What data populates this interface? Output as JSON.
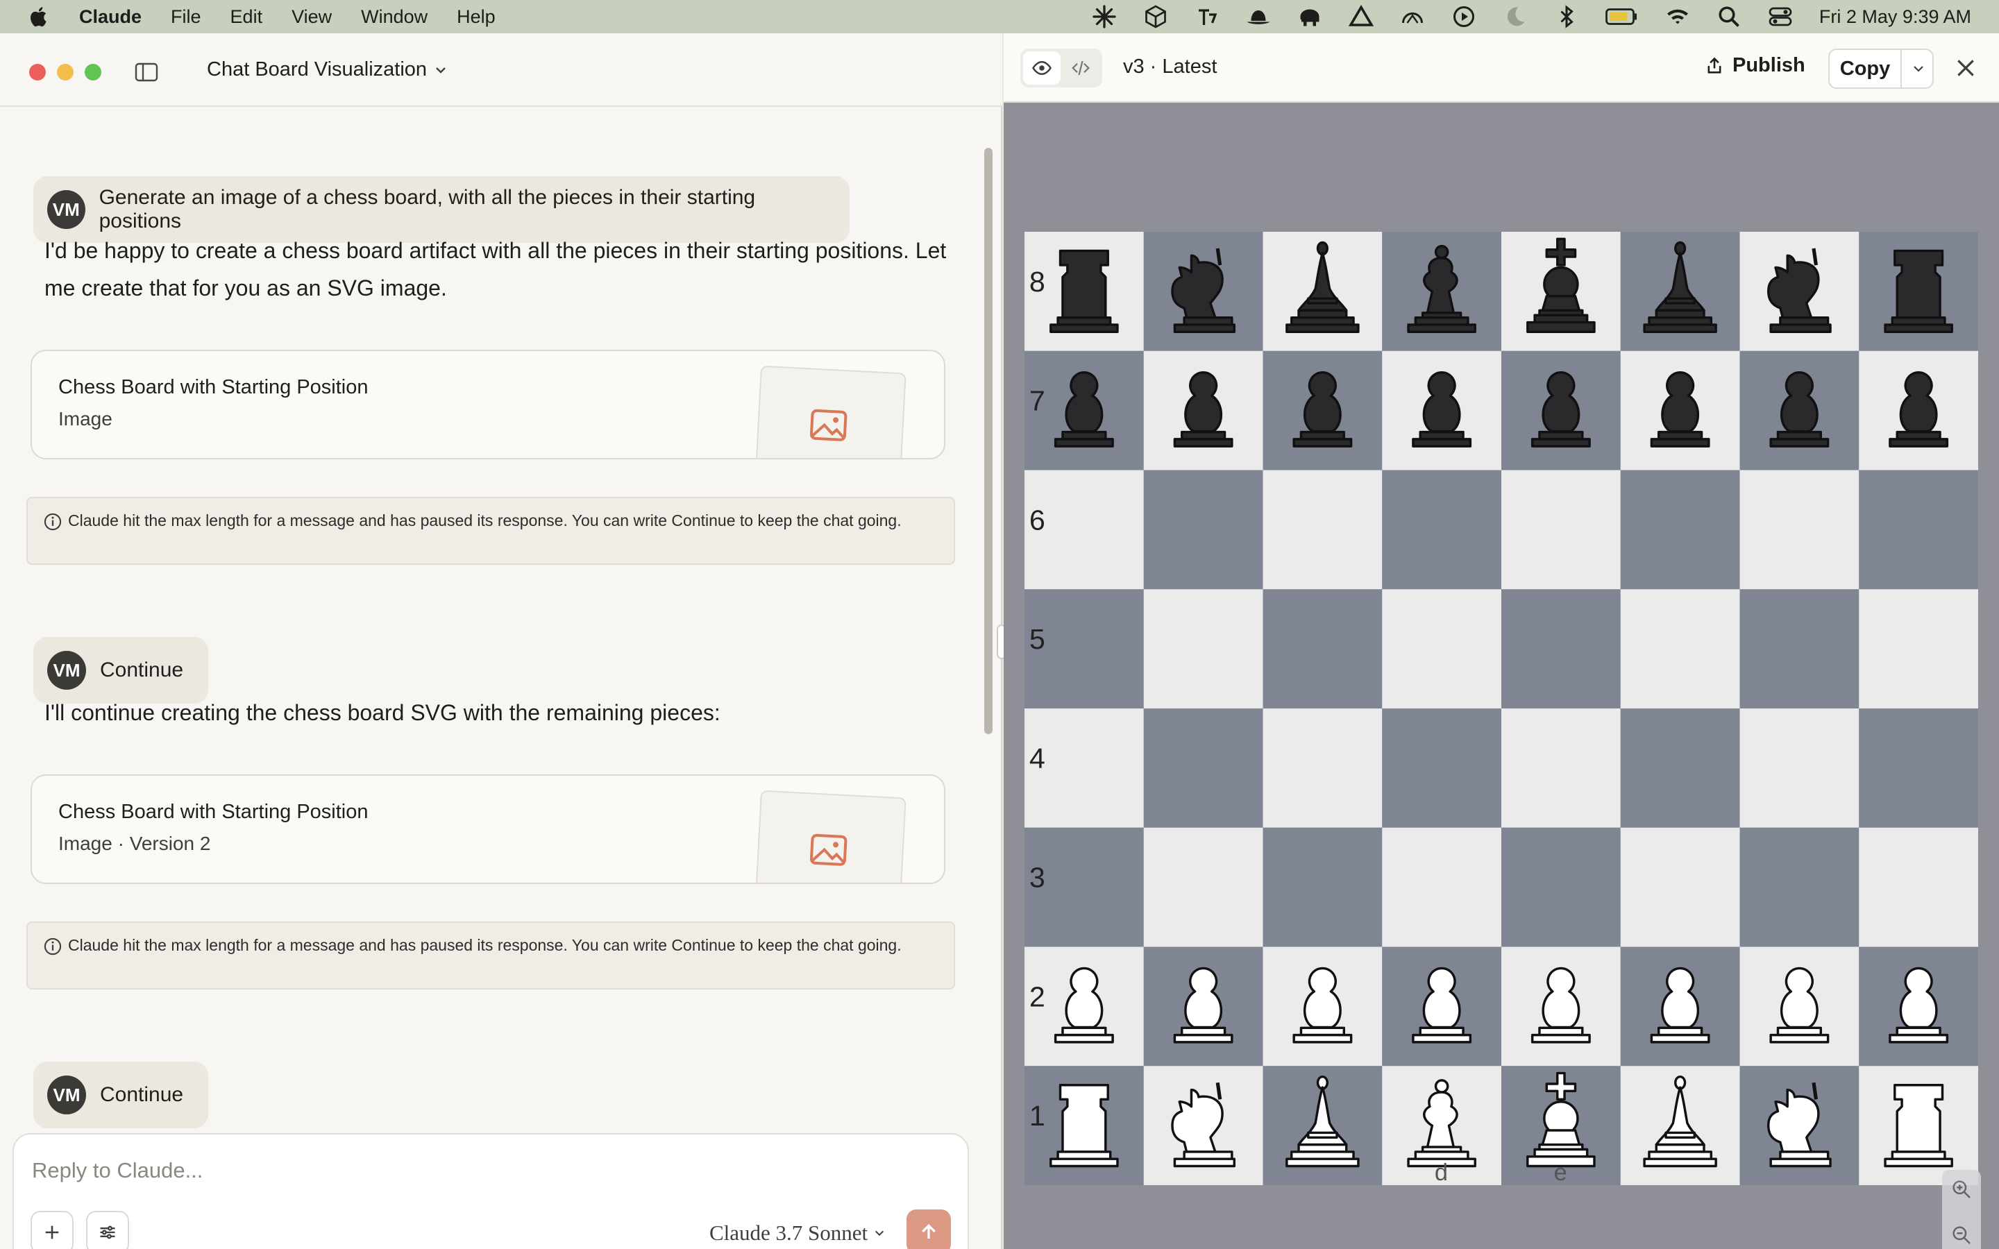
{
  "menubar": {
    "app_name": "Claude",
    "menus": [
      "File",
      "Edit",
      "View",
      "Window",
      "Help"
    ],
    "clock": "Fri 2 May  9:39 AM",
    "status_icons": [
      "claude-spark-icon",
      "box-icon",
      "agent-icon",
      "bowler-hat-icon",
      "elephant-icon",
      "drive-icon",
      "speedometer-icon",
      "play-circle-icon",
      "moon-icon",
      "bluetooth-icon",
      "battery-icon",
      "wifi-icon",
      "search-icon",
      "control-center-icon"
    ]
  },
  "chat": {
    "title": "Chat Board Visualization",
    "messages": [
      {
        "role": "user",
        "initials": "VM",
        "text": "Generate an image of a chess board, with all the pieces in their starting positions"
      },
      {
        "role": "assistant",
        "text": "I'd be happy to create a chess board artifact with all the pieces in their starting positions. Let me create that for you as an SVG image."
      },
      {
        "role": "artifact",
        "title": "Chess Board with Starting Position",
        "subtitle": "Image"
      },
      {
        "role": "notice",
        "text": "Claude hit the max length for a message and has paused its response. You can write Continue to keep the chat going."
      },
      {
        "role": "user",
        "initials": "VM",
        "text": "Continue"
      },
      {
        "role": "assistant",
        "text": "I'll continue creating the chess board SVG with the remaining pieces:"
      },
      {
        "role": "artifact",
        "title": "Chess Board with Starting Position",
        "subtitle": "Image  ·  Version 2"
      },
      {
        "role": "notice",
        "text": "Claude hit the max length for a message and has paused its response. You can write Continue to keep the chat going."
      },
      {
        "role": "user",
        "initials": "VM",
        "text": "Continue"
      }
    ]
  },
  "composer": {
    "placeholder": "Reply to Claude...",
    "model": "Claude 3.7 Sonnet"
  },
  "panel": {
    "version": "v3 · Latest",
    "publish_label": "Publish",
    "copy_label": "Copy"
  },
  "board": {
    "rank_labels": [
      "8",
      "7",
      "6",
      "5",
      "4",
      "3",
      "2",
      "1"
    ],
    "file_labels_visible": [
      "d",
      "e"
    ],
    "light_square": "#ebebeb",
    "dark_square": "#7f8593",
    "ranks": [
      [
        "r",
        "n",
        "b",
        "q",
        "k",
        "b",
        "n",
        "r"
      ],
      [
        "p",
        "p",
        "p",
        "p",
        "p",
        "p",
        "p",
        "p"
      ],
      [
        "",
        "",
        "",
        "",
        "",
        "",
        "",
        ""
      ],
      [
        "",
        "",
        "",
        "",
        "",
        "",
        "",
        ""
      ],
      [
        "",
        "",
        "",
        "",
        "",
        "",
        "",
        ""
      ],
      [
        "",
        "",
        "",
        "",
        "",
        "",
        "",
        ""
      ],
      [
        "P",
        "P",
        "P",
        "P",
        "P",
        "P",
        "P",
        "P"
      ],
      [
        "R",
        "N",
        "B",
        "Q",
        "K",
        "B",
        "N",
        "R"
      ]
    ]
  }
}
